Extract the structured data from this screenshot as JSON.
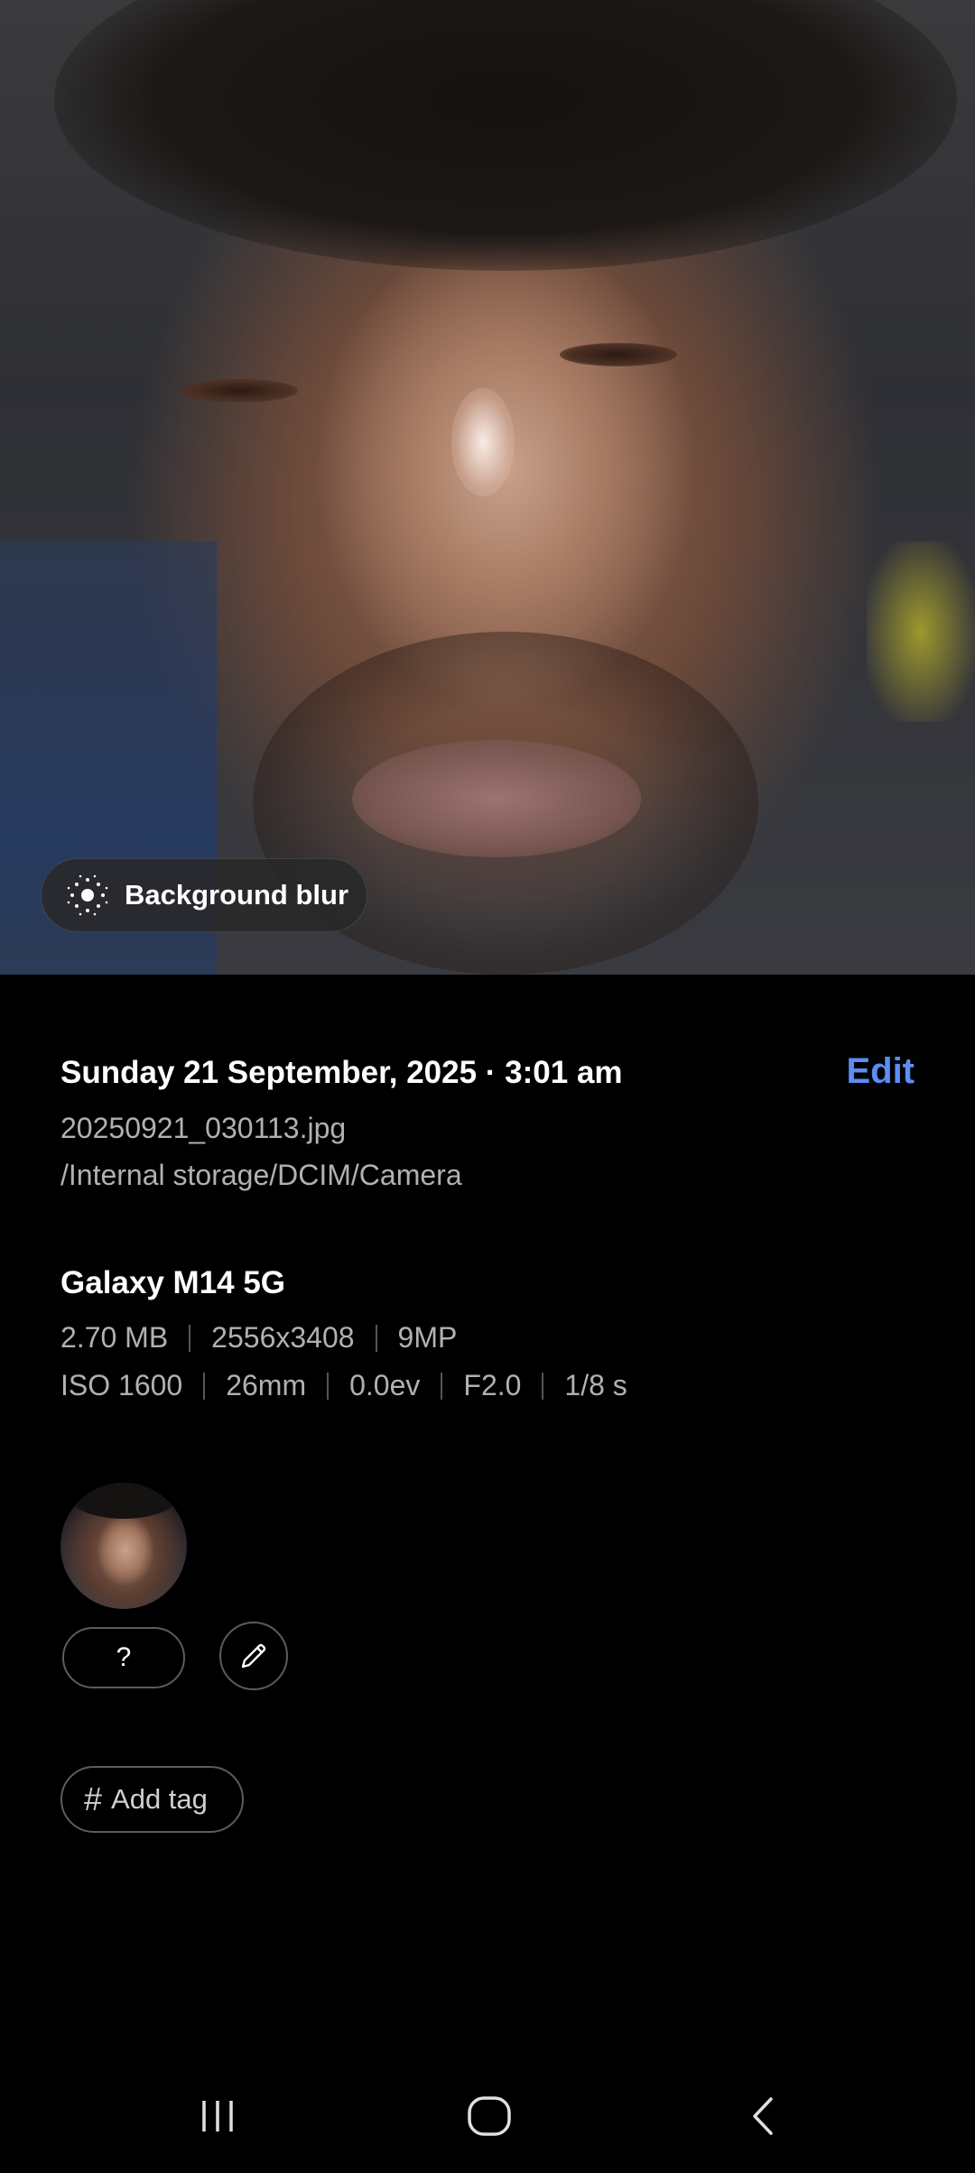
{
  "photo": {
    "background_blur_label": "Background blur"
  },
  "details": {
    "date_time": "Sunday 21 September, 2025 · 3:01 am",
    "edit_label": "Edit",
    "filename": "20250921_030113.jpg",
    "path": "/Internal storage/DCIM/Camera",
    "device": "Galaxy M14 5G",
    "file_meta": [
      "2.70 MB",
      "2556x3408",
      "9MP"
    ],
    "camera_meta": [
      "ISO 1600",
      "26mm",
      "0.0ev",
      "F2.0",
      "1/8 s"
    ]
  },
  "people": {
    "unknown_label": "?"
  },
  "tags": {
    "add_tag_label": "Add tag"
  },
  "nav": {
    "recents": "recents-icon",
    "home": "home-icon",
    "back": "back-icon"
  },
  "colors": {
    "accent": "#5d8cf5",
    "background": "#000000",
    "secondary_text": "#b1b1b1"
  }
}
